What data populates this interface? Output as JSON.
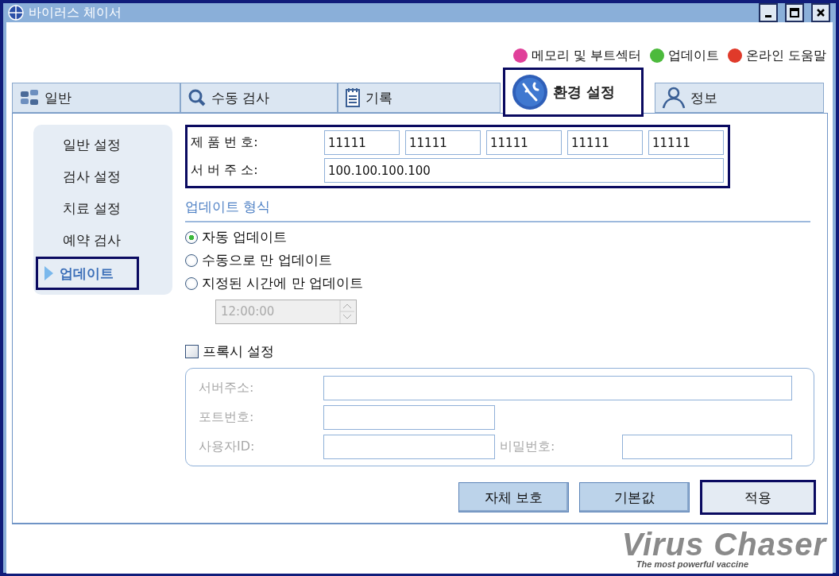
{
  "window": {
    "title": "바이러스 체이서"
  },
  "top_links": [
    {
      "label": "메모리 및 부트섹터",
      "color": "#e0409a"
    },
    {
      "label": "업데이트",
      "color": "#4cba3c"
    },
    {
      "label": "온라인 도움말",
      "color": "#e03a2a"
    }
  ],
  "tabs": [
    {
      "label": "일반",
      "selected": false
    },
    {
      "label": "수동 검사",
      "selected": false
    },
    {
      "label": "기록",
      "selected": false
    },
    {
      "label": "환경 설정",
      "selected": true
    },
    {
      "label": "정보",
      "selected": false
    }
  ],
  "sidebar": {
    "items": [
      {
        "label": "일반 설정",
        "selected": false
      },
      {
        "label": "검사 설정",
        "selected": false
      },
      {
        "label": "치료 설정",
        "selected": false
      },
      {
        "label": "예약 검사",
        "selected": false
      },
      {
        "label": "업데이트",
        "selected": true
      }
    ]
  },
  "registration": {
    "focused": true,
    "product_number_label": "제 품 번 호:",
    "product_number": [
      "11111",
      "11111",
      "11111",
      "11111",
      "11111"
    ],
    "server_address_label": "서 버 주 소:",
    "server_address": "100.100.100.100"
  },
  "update_type": {
    "title": "업데이트 형식",
    "options": [
      {
        "label": "자동 업데이트",
        "selected": true
      },
      {
        "label": "수동으로 만 업데이트",
        "selected": false
      },
      {
        "label": "지정된 시간에 만 업데이트",
        "selected": false
      }
    ],
    "time": {
      "value": "12:00:00",
      "disabled": true
    }
  },
  "proxy": {
    "label": "프록시 설정",
    "checked": false,
    "server_label": "서버주소:",
    "port_label": "포트번호:",
    "user_label": "사용자ID:",
    "password_label": "비밀번호:"
  },
  "buttons": [
    {
      "label": "자체 보호",
      "focused": false
    },
    {
      "label": "기본값",
      "focused": false
    },
    {
      "label": "적용",
      "focused": true
    }
  ],
  "logo": {
    "name": "Virus Chaser",
    "tagline": "The most powerful vaccine"
  }
}
